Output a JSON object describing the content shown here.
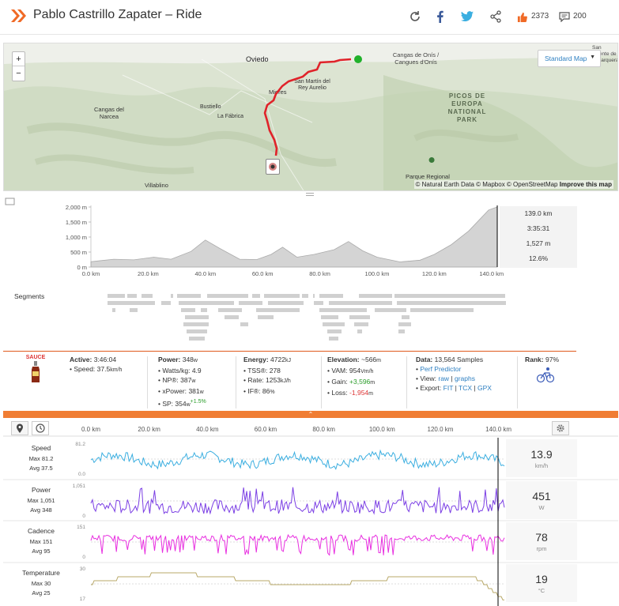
{
  "header": {
    "title": "Pablo Castrillo Zapater – Ride",
    "kudos": "2373",
    "comments": "200"
  },
  "map": {
    "labels": [
      "Oviedo",
      "Cangas de Onís / Cangues d'Onís",
      "Mieres",
      "San Martín del Rey Aurelio",
      "Bustiello",
      "La Fábrica",
      "Cangas del Narcea",
      "PICOS DE EUROPA NATIONAL PARK",
      "Parque Regional",
      "Villablino",
      "San Vicente de la Barquera"
    ],
    "style": "Standard Map",
    "attribution": "© Natural Earth Data © Mapbox © OpenStreetMap",
    "improve": "Improve this map",
    "colors": {
      "route": "#e0232a",
      "start": "#21b12b"
    }
  },
  "elevation": {
    "y_ticks": [
      "2,000 m",
      "1,500 m",
      "1,000 m",
      "500 m",
      "0 m"
    ],
    "x_ticks": [
      "0.0 km",
      "20.0 km",
      "40.0 km",
      "60.0 km",
      "80.0 km",
      "100.0 km",
      "120.0 km",
      "140.0 km"
    ],
    "readout": [
      "139.0 km",
      "3:35:31",
      "1,527 m",
      "12.6%"
    ],
    "segments_label": "Segments"
  },
  "stats": {
    "sauce": "SAUCE",
    "active_label": "Active:",
    "active_val": "3:46:04",
    "speed_label": "Speed:",
    "speed_val": "37.5",
    "speed_unit": "km/h",
    "power_label": "Power:",
    "power_val": "348",
    "power_unit": "w",
    "wkg_label": "Watts/kg:",
    "wkg_val": "4.9",
    "np_label": "NP®:",
    "np_val": "387",
    "np_unit": "w",
    "xp_label": "xPower:",
    "xp_val": "381",
    "xp_unit": "w",
    "sp_label": "SP:",
    "sp_val": "354",
    "sp_unit": "w",
    "sp_delta": "+1.5%",
    "energy_label": "Energy:",
    "energy_val": "4722",
    "energy_unit": "kJ",
    "tss_label": "TSS®:",
    "tss_val": "278",
    "rate_label": "Rate:",
    "rate_val": "1253",
    "rate_unit": "kJ/h",
    "if_label": "IF®:",
    "if_val": "86",
    "if_unit": "%",
    "elev_label": "Elevation:",
    "elev_val": "~566",
    "elev_unit": "m",
    "vam_label": "VAM:",
    "vam_val": "954",
    "vam_unit": "Vm/h",
    "gain_label": "Gain:",
    "gain_val": "+3,596",
    "gain_unit": "m",
    "loss_label": "Loss:",
    "loss_val": "-1,954",
    "loss_unit": "m",
    "data_label": "Data:",
    "data_val": "13,564 Samples",
    "perf": "Perf Predictor",
    "view_label": "View:",
    "view_raw": "raw",
    "view_graphs": "graphs",
    "export_label": "Export:",
    "fit": "FIT",
    "tcx": "TCX",
    "gpx": "GPX",
    "rank_label": "Rank:",
    "rank_val": "97%"
  },
  "timeline": {
    "x_ticks": [
      "0.0 km",
      "20.0 km",
      "40.0 km",
      "60.0 km",
      "80.0 km",
      "100.0 km",
      "120.0 km",
      "140.0 km"
    ],
    "rows": [
      {
        "name": "Speed",
        "max": "Max 81.2",
        "avg": "Avg 37.5",
        "ymax": "81.2",
        "ymin": "0.0",
        "value": "13.9",
        "unit": "km/h",
        "color": "#3aaee0"
      },
      {
        "name": "Power",
        "max": "Max 1,051",
        "avg": "Avg 348",
        "ymax": "1,051",
        "ymin": "0",
        "value": "451",
        "unit": "W",
        "color": "#7b3fe4"
      },
      {
        "name": "Cadence",
        "max": "Max 151",
        "avg": "Avg 95",
        "ymax": "151",
        "ymin": "0",
        "value": "78",
        "unit": "rpm",
        "color": "#e82fe0"
      },
      {
        "name": "Temperature",
        "max": "Max 30",
        "avg": "Avg 25",
        "ymax": "30",
        "ymin": "17",
        "value": "19",
        "unit": "°C",
        "color": "#b8a868"
      }
    ]
  }
}
